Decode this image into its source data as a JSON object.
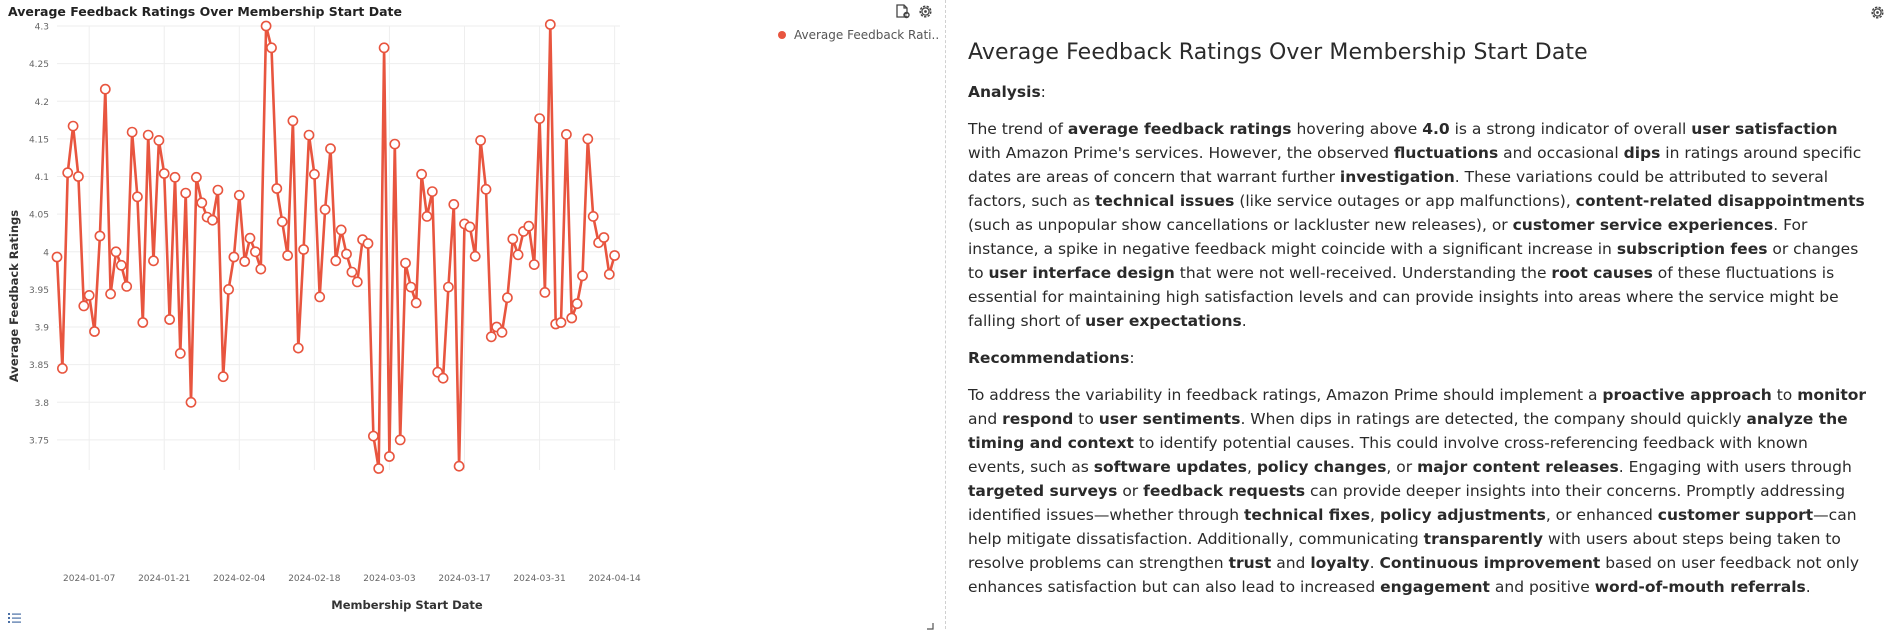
{
  "chart_data": {
    "type": "line",
    "title": "Average Feedback Ratings Over Membership Start Date",
    "xlabel": "Membership Start Date",
    "ylabel": "Average Feedback Ratings",
    "ylim": [
      3.71,
      4.3
    ],
    "yticks": [
      "4.3",
      "4.25",
      "4.2",
      "4.15",
      "4.1",
      "4.05",
      "4",
      "3.95",
      "3.9",
      "3.85",
      "3.8",
      "3.75"
    ],
    "xticks": [
      "2024-01-07",
      "2024-01-21",
      "2024-02-04",
      "2024-02-18",
      "2024-03-03",
      "2024-03-17",
      "2024-03-31",
      "2024-04-14"
    ],
    "x_start": "2024-01-01",
    "x_end": "2024-04-15",
    "grid": true,
    "legend_position": "top-right",
    "color": "#e8553f",
    "series": [
      {
        "name": "Average Feedback Rati...",
        "values": [
          3.993,
          3.845,
          4.105,
          4.167,
          4.1,
          3.928,
          3.942,
          3.894,
          4.021,
          4.216,
          3.944,
          4.0,
          3.982,
          3.954,
          4.159,
          4.073,
          3.906,
          4.155,
          3.988,
          4.148,
          4.104,
          3.91,
          4.099,
          3.865,
          4.078,
          3.8,
          4.099,
          4.065,
          4.046,
          4.042,
          4.082,
          3.834,
          3.95,
          3.993,
          4.075,
          3.987,
          4.018,
          4.0,
          3.977,
          4.3,
          4.271,
          4.084,
          4.04,
          3.995,
          4.174,
          3.872,
          4.003,
          4.155,
          4.103,
          3.94,
          4.056,
          4.137,
          3.988,
          4.029,
          3.997,
          3.973,
          3.96,
          4.016,
          4.011,
          3.755,
          3.712,
          4.271,
          3.728,
          4.143,
          3.75,
          3.985,
          3.953,
          3.932,
          4.103,
          4.047,
          4.08,
          3.84,
          3.832,
          3.953,
          4.063,
          3.715,
          4.037,
          4.033,
          3.994,
          4.148,
          4.083,
          3.887,
          3.9,
          3.893,
          3.939,
          4.017,
          3.996,
          4.027,
          4.034,
          3.983,
          4.177,
          3.946,
          4.302,
          3.904,
          3.906,
          4.156,
          3.912,
          3.931,
          3.968,
          4.15,
          4.047,
          4.012,
          4.019,
          3.97,
          3.995
        ]
      }
    ]
  },
  "analysis": {
    "title": "Average Feedback Ratings Over Membership Start Date",
    "analysis_heading": "Analysis",
    "recommendations_heading": "Recommendations",
    "analysis_text": [
      {
        "t": "The trend of "
      },
      {
        "b": "average feedback ratings"
      },
      {
        "t": " hovering above "
      },
      {
        "b": "4.0"
      },
      {
        "t": " is a strong indicator of overall "
      },
      {
        "b": "user satisfaction"
      },
      {
        "t": " with Amazon Prime's services. However, the observed "
      },
      {
        "b": "fluctuations"
      },
      {
        "t": " and occasional "
      },
      {
        "b": "dips"
      },
      {
        "t": " in ratings around specific dates are areas of concern that warrant further "
      },
      {
        "b": "investigation"
      },
      {
        "t": ". These variations could be attributed to several factors, such as "
      },
      {
        "b": "technical issues"
      },
      {
        "t": " (like service outages or app malfunctions), "
      },
      {
        "b": "content-related disappointments"
      },
      {
        "t": " (such as unpopular show cancellations or lackluster new releases), or "
      },
      {
        "b": "customer service experiences"
      },
      {
        "t": ". For instance, a spike in negative feedback might coincide with a significant increase in "
      },
      {
        "b": "subscription fees"
      },
      {
        "t": " or changes to "
      },
      {
        "b": "user interface design"
      },
      {
        "t": " that were not well-received. Understanding the "
      },
      {
        "b": "root causes"
      },
      {
        "t": " of these fluctuations is essential for maintaining high satisfaction levels and can provide insights into areas where the service might be falling short of "
      },
      {
        "b": "user expectations"
      },
      {
        "t": "."
      }
    ],
    "recommendations_text": [
      {
        "t": "To address the variability in feedback ratings, Amazon Prime should implement a "
      },
      {
        "b": "proactive approach"
      },
      {
        "t": " to "
      },
      {
        "b": "monitor"
      },
      {
        "t": " and "
      },
      {
        "b": "respond"
      },
      {
        "t": " to "
      },
      {
        "b": "user sentiments"
      },
      {
        "t": ". When dips in ratings are detected, the company should quickly "
      },
      {
        "b": "analyze the timing and context"
      },
      {
        "t": " to identify potential causes. This could involve cross-referencing feedback with known events, such as "
      },
      {
        "b": "software updates"
      },
      {
        "t": ", "
      },
      {
        "b": "policy changes"
      },
      {
        "t": ", or "
      },
      {
        "b": "major content releases"
      },
      {
        "t": ". Engaging with users through "
      },
      {
        "b": "targeted surveys"
      },
      {
        "t": " or "
      },
      {
        "b": "feedback requests"
      },
      {
        "t": " can provide deeper insights into their concerns. Promptly addressing identified issues—whether through "
      },
      {
        "b": "technical fixes"
      },
      {
        "t": ", "
      },
      {
        "b": "policy adjustments"
      },
      {
        "t": ", or enhanced "
      },
      {
        "b": "customer support"
      },
      {
        "t": "—can help mitigate dissatisfaction. Additionally, communicating "
      },
      {
        "b": "transparently"
      },
      {
        "t": " with users about steps being taken to resolve problems can strengthen "
      },
      {
        "b": "trust"
      },
      {
        "t": " and "
      },
      {
        "b": "loyalty"
      },
      {
        "t": ". "
      },
      {
        "b": "Continuous improvement"
      },
      {
        "t": " based on user feedback not only enhances satisfaction but can also lead to increased "
      },
      {
        "b": "engagement"
      },
      {
        "t": " and positive "
      },
      {
        "b": "word-of-mouth referrals"
      },
      {
        "t": "."
      }
    ]
  },
  "icons": {
    "export": "export-icon",
    "settings": "gear-icon",
    "list": "list-icon",
    "resize": "resize-grip-icon"
  }
}
